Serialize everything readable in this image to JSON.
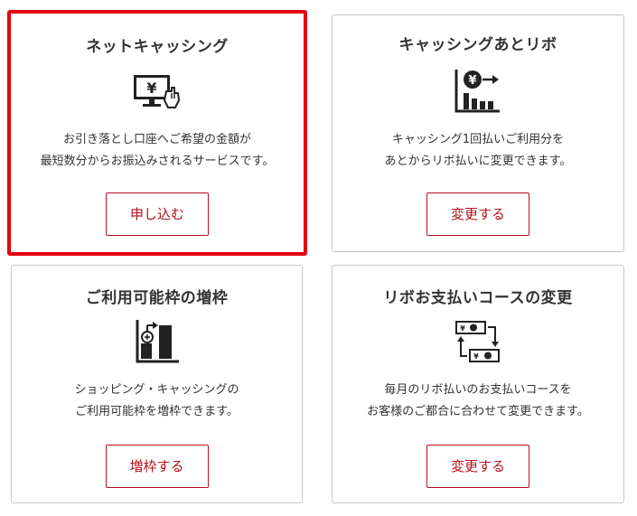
{
  "cards": [
    {
      "title": "ネットキャッシング",
      "icon": "monitor-yen-icon",
      "desc_line1": "お引き落とし口座へご希望の金額が",
      "desc_line2": "最短数分からお振込みされるサービスです。",
      "button_label": "申し込む"
    },
    {
      "title": "キャッシングあとリボ",
      "icon": "yen-chart-icon",
      "desc_line1": "キャッシング1回払いご利用分を",
      "desc_line2": "あとからリボ払いに変更できます。",
      "button_label": "変更する"
    },
    {
      "title": "ご利用可能枠の増枠",
      "icon": "limit-increase-icon",
      "desc_line1": "ショッピング・キャッシングの",
      "desc_line2": "ご利用可能枠を増枠できます。",
      "button_label": "増枠する"
    },
    {
      "title": "リボお支払いコースの変更",
      "icon": "payment-exchange-icon",
      "desc_line1": "毎月のリボ払いのお支払いコースを",
      "desc_line2": "お客様のご都合に合わせて変更できます。",
      "button_label": "変更する"
    }
  ],
  "colors": {
    "accent": "#b5121b",
    "highlight": "#e60012",
    "border": "#c8c8c8",
    "text": "#333333"
  }
}
